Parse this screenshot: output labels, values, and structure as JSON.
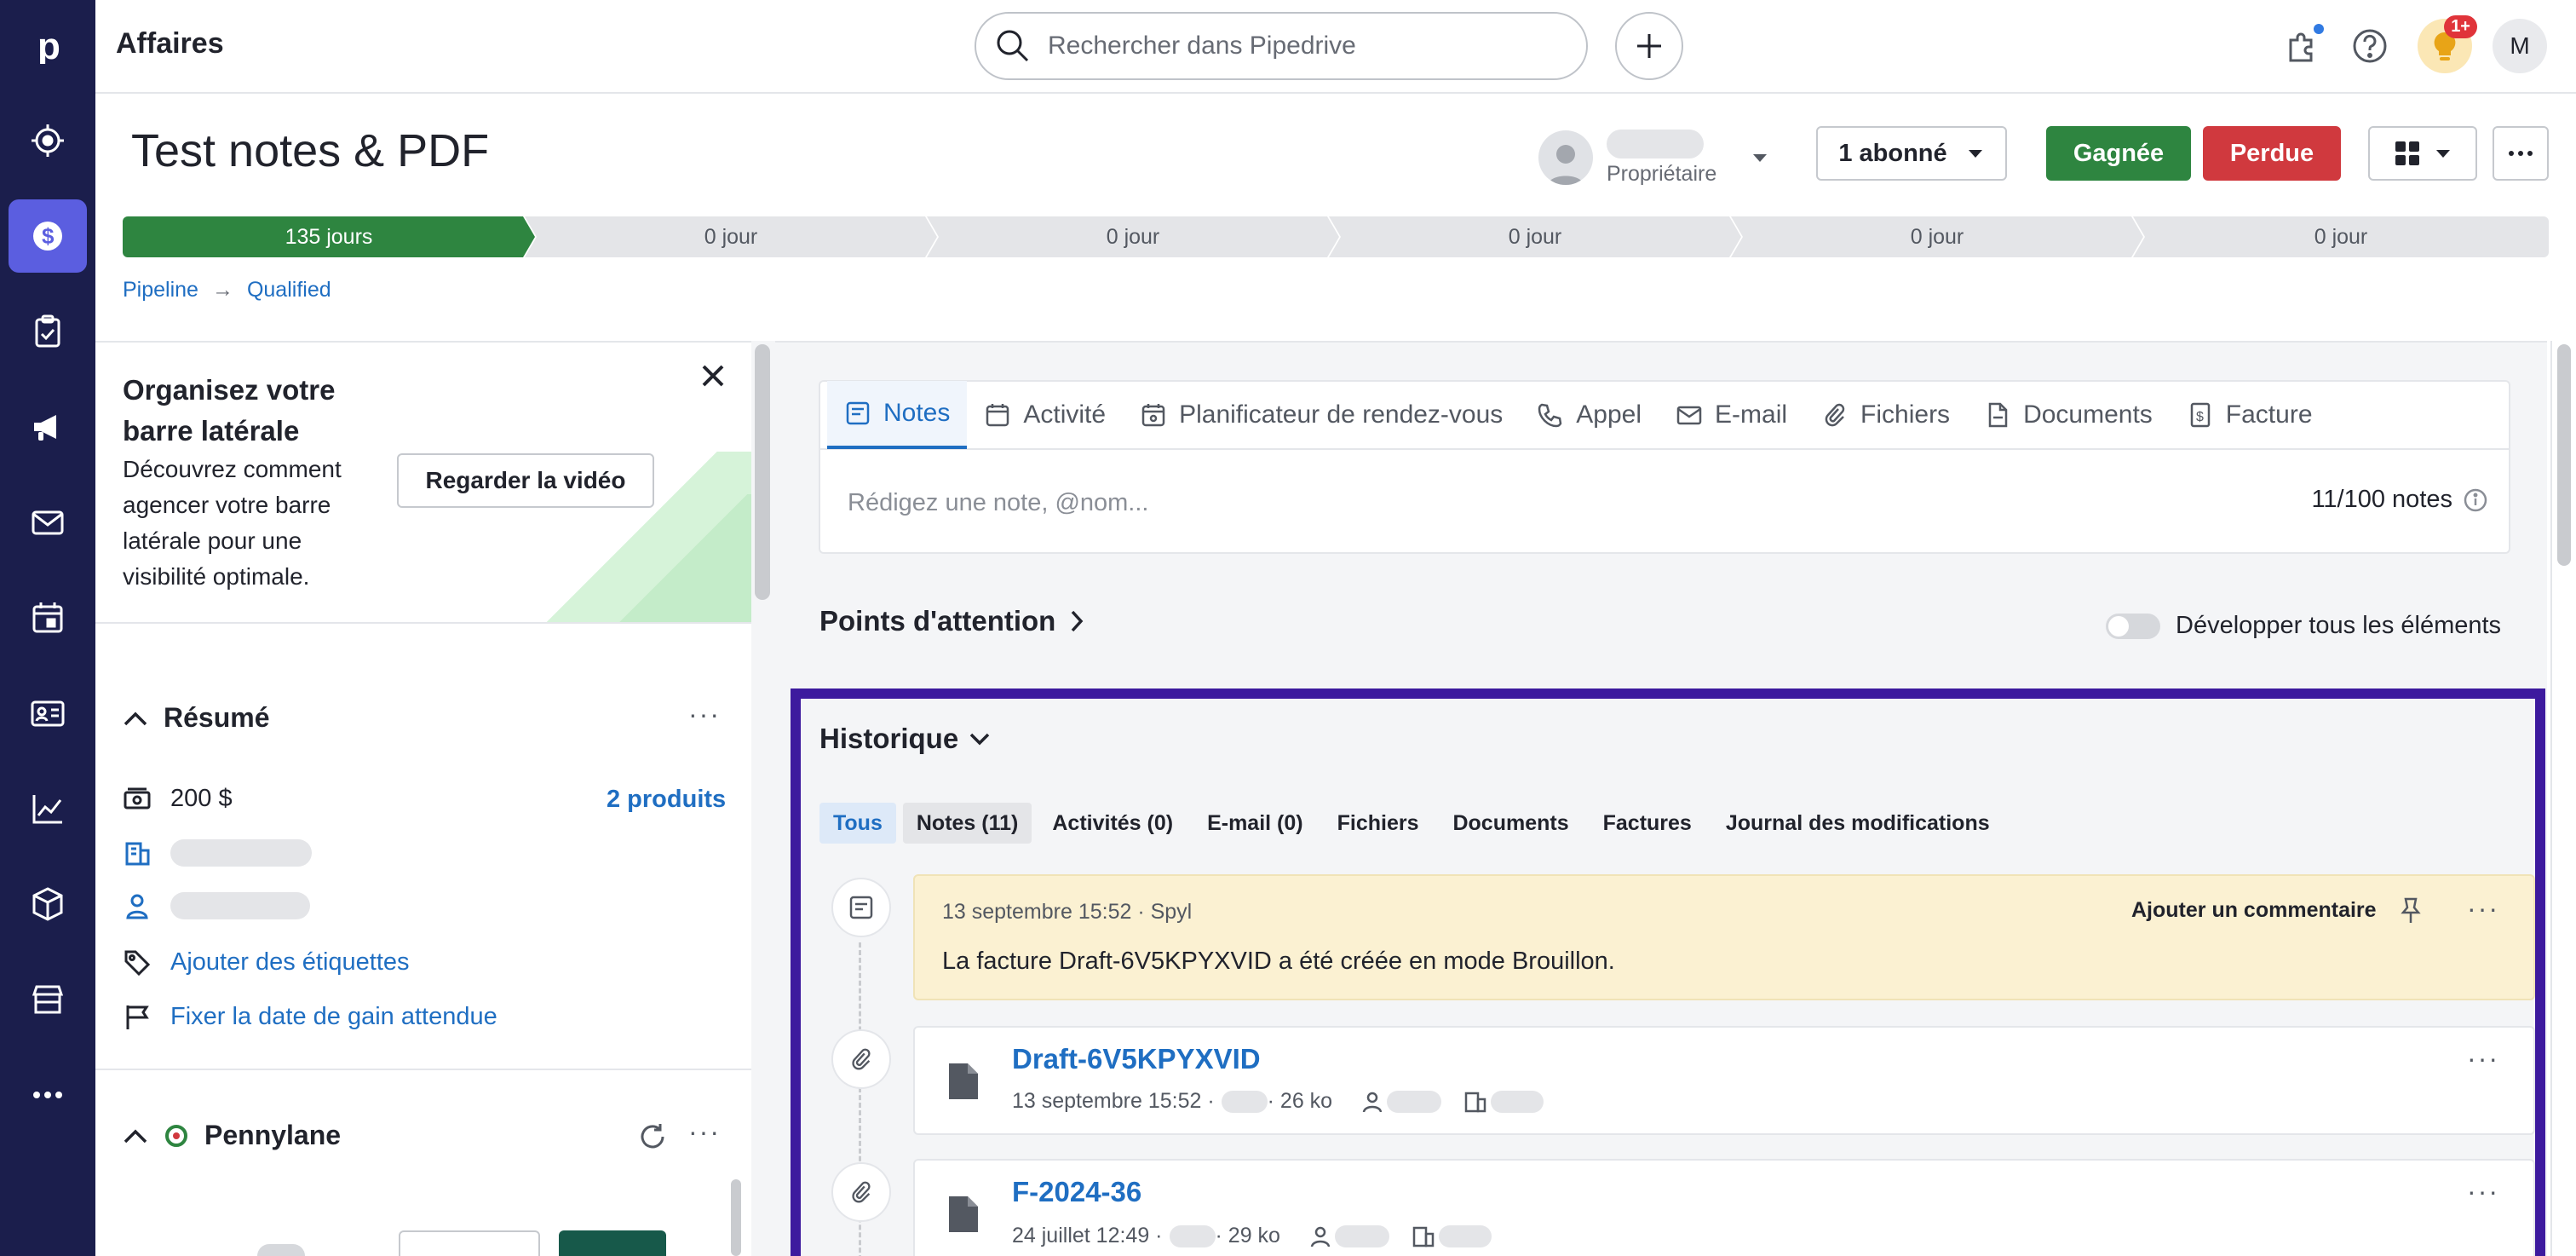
{
  "nav": {
    "items": [
      "logo",
      "deals-target",
      "deals",
      "activities",
      "campaigns",
      "mail",
      "calendar",
      "contacts",
      "insights",
      "products",
      "marketplace",
      "more"
    ]
  },
  "topbar": {
    "app_title": "Affaires",
    "search_placeholder": "Rechercher dans Pipedrive",
    "notif_badge": "1+",
    "avatar_initial": "M"
  },
  "deal": {
    "title": "Test notes & PDF",
    "owner_role": "Propriétaire",
    "follow_label": "1 abonné",
    "won_label": "Gagnée",
    "lost_label": "Perdue",
    "stages": [
      "135 jours",
      "0 jour",
      "0 jour",
      "0 jour",
      "0 jour",
      "0 jour"
    ],
    "breadcrumb": [
      "Pipeline",
      "Qualified"
    ]
  },
  "promo": {
    "title": "Organisez votre barre latérale",
    "body": "Découvrez comment agencer votre barre latérale pour une visibilité optimale.",
    "video_button": "Regarder la vidéo"
  },
  "summary": {
    "title": "Résumé",
    "amount": "200 $",
    "products_link": "2 produits",
    "add_labels": "Ajouter des étiquettes",
    "set_close_date": "Fixer la date de gain attendue"
  },
  "pennylane": {
    "title": "Pennylane"
  },
  "composer": {
    "tabs": [
      "Notes",
      "Activité",
      "Planificateur de rendez-vous",
      "Appel",
      "E-mail",
      "Fichiers",
      "Documents",
      "Facture"
    ],
    "placeholder": "Rédigez une note, @nom...",
    "count": "11/100 notes"
  },
  "focus": {
    "title": "Points d'attention",
    "expand_label": "Développer tous les éléments"
  },
  "history": {
    "title": "Historique",
    "filters": [
      "Tous",
      "Notes (11)",
      "Activités (0)",
      "E-mail (0)",
      "Fichiers",
      "Documents",
      "Factures",
      "Journal des modifications"
    ],
    "note": {
      "meta": "13 septembre 15:52 · Spyl",
      "comment_label": "Ajouter un commentaire",
      "text": "La facture Draft-6V5KPYXVID a été créée en mode Brouillon."
    },
    "files": [
      {
        "name": "Draft-6V5KPYXVID",
        "date": "13 septembre 15:52 ·",
        "size": "· 26 ko"
      },
      {
        "name": "F-2024-36",
        "date": "24 juillet 12:49 ·",
        "size": "· 29 ko"
      }
    ]
  },
  "colors": {
    "nav_bg": "#1b1e4c",
    "nav_active": "#5b5ee0",
    "won": "#2e8540",
    "lost": "#d0393e",
    "link": "#1f6ec2",
    "highlight_border": "#3d1a9e",
    "note_bg": "#fbf1d2"
  }
}
